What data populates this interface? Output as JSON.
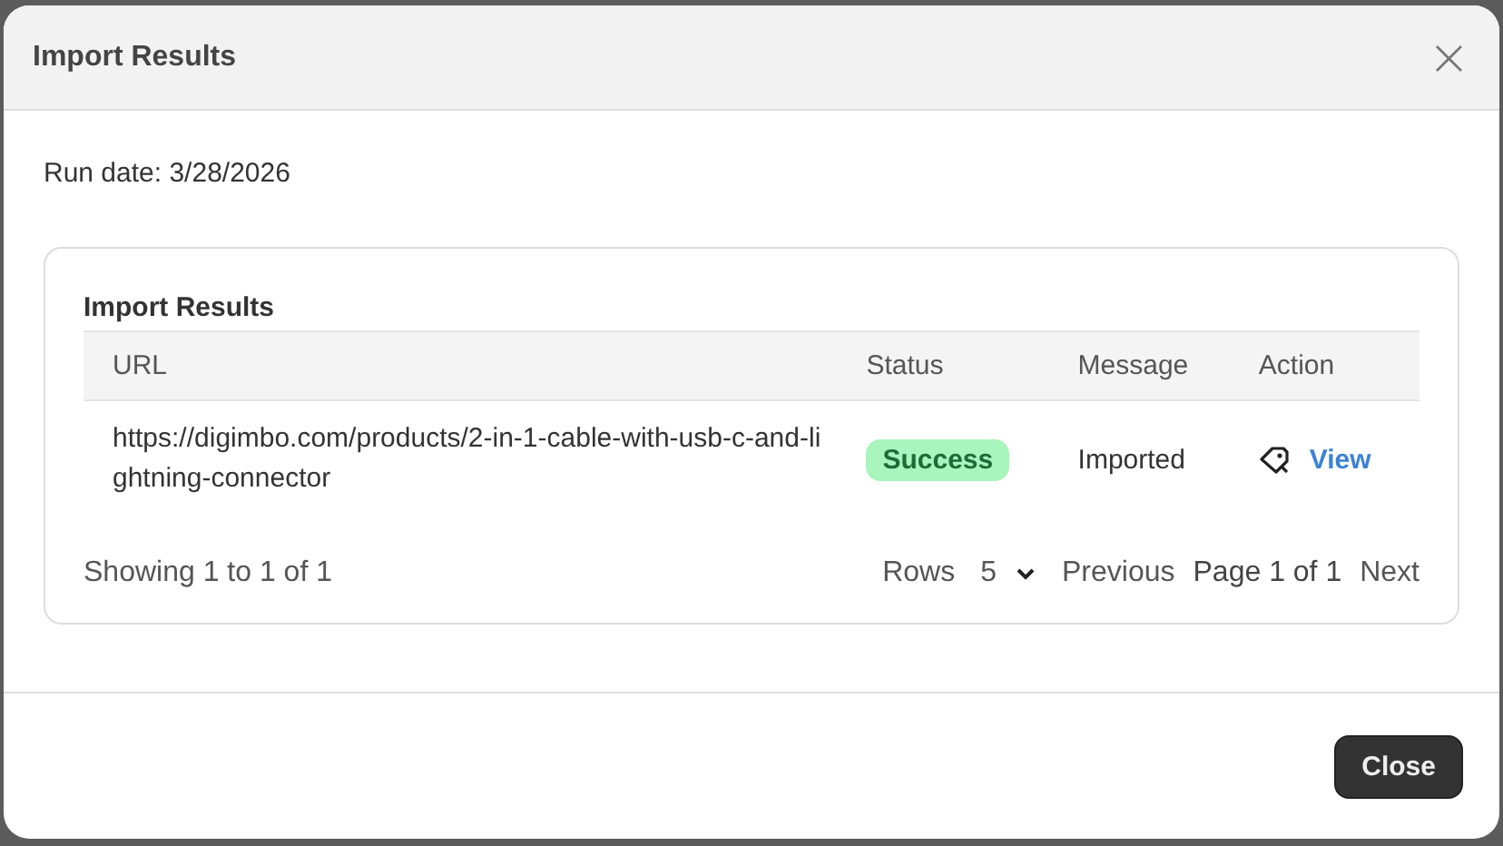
{
  "dialog": {
    "title": "Import Results",
    "close_icon": "×"
  },
  "run_date": "Run date: 3/28/2026",
  "card": {
    "title": "Import Results",
    "table": {
      "columns": [
        "URL",
        "Status",
        "Message",
        "Action"
      ],
      "rows": [
        {
          "url": "https://digimbo.com/products/2-in-1-cable-with-usb-c-and-lightning-connector",
          "status": "Success",
          "kind": "success",
          "message": "Imported",
          "action": "View"
        }
      ]
    },
    "footer": {
      "summary": "Showing 1 to 1 of 1",
      "rows_label": "Rows",
      "rows_value": "5",
      "previous": "Previous",
      "page": "Page 1 of 1",
      "next": "Next"
    }
  },
  "buttons": [
    "Close"
  ]
}
